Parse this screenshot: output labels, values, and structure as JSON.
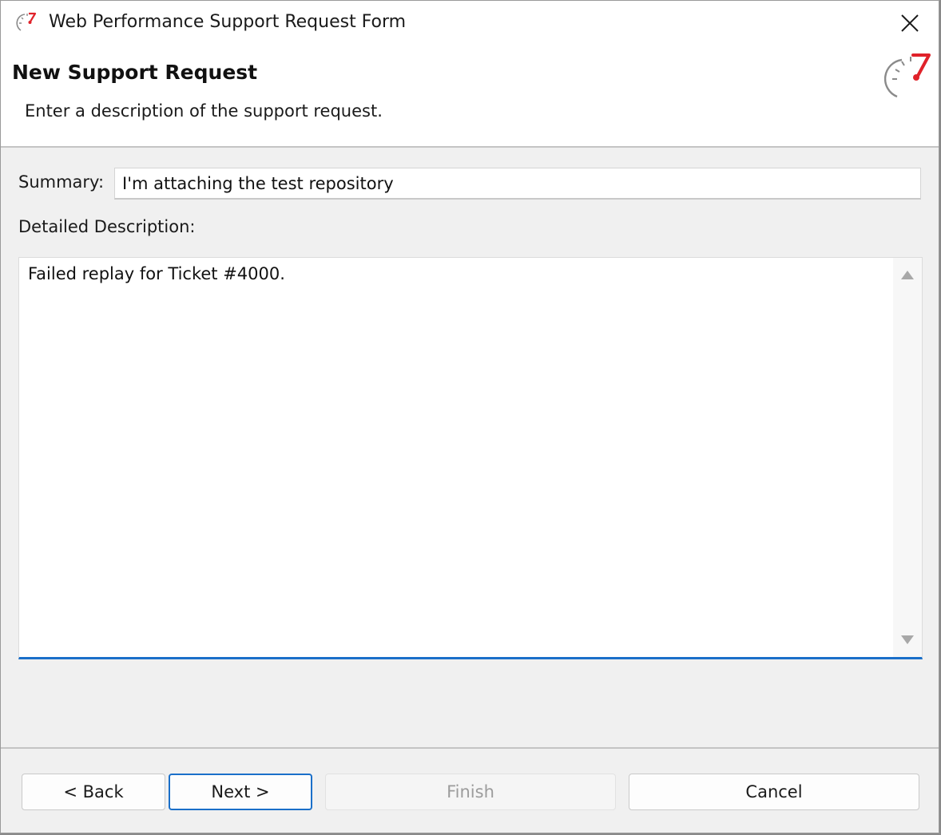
{
  "window": {
    "title": "Web Performance Support Request Form",
    "close_icon": "close-icon"
  },
  "header": {
    "title": "New Support Request",
    "subtitle": "Enter a description of the support request.",
    "icon": "speedometer-icon"
  },
  "form": {
    "summary_label": "Summary:",
    "summary_value": "I'm attaching the test repository",
    "description_label": "Detailed Description:",
    "description_value": "Failed replay for Ticket #4000."
  },
  "buttons": {
    "back": "< Back",
    "next": "Next >",
    "finish": "Finish",
    "cancel": "Cancel"
  },
  "colors": {
    "accent": "#1a6fc9",
    "brand_red": "#e0222a"
  }
}
